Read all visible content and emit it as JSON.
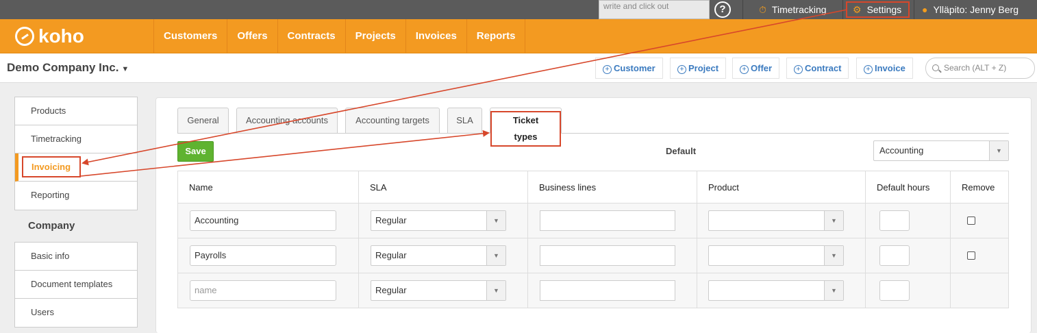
{
  "topbar": {
    "note_text": "write and click out",
    "help": "?",
    "timetracking": "Timetracking",
    "settings": "Settings",
    "user": "Ylläpito: Jenny Berg"
  },
  "brand": {
    "logo": "koho",
    "accent": "#f39a21",
    "annotation": "#d7472b"
  },
  "nav": {
    "items": [
      "Customers",
      "Offers",
      "Contracts",
      "Projects",
      "Invoices",
      "Reports"
    ]
  },
  "header": {
    "company": "Demo Company Inc.",
    "quick_add": [
      "Customer",
      "Project",
      "Offer",
      "Contract",
      "Invoice"
    ],
    "search_placeholder": "Search (ALT + Z)"
  },
  "sidebar": {
    "settings_items": [
      "Products",
      "Timetracking",
      "Invoicing",
      "Reporting"
    ],
    "active": "Invoicing",
    "company_heading": "Company",
    "company_items": [
      "Basic info",
      "Document templates",
      "Users"
    ]
  },
  "tabs": [
    "General",
    "Accounting accounts",
    "Accounting targets",
    "SLA",
    "Ticket types"
  ],
  "active_tab": "Ticket types",
  "toolbar": {
    "save": "Save",
    "default_label": "Default",
    "default_value": "Accounting"
  },
  "table": {
    "headers": [
      "Name",
      "SLA",
      "Business lines",
      "Product",
      "Default hours",
      "Remove"
    ],
    "rows": [
      {
        "name": "Accounting",
        "sla": "Regular",
        "business_lines": "",
        "product": "",
        "hours": "",
        "remove": false
      },
      {
        "name": "Payrolls",
        "sla": "Regular",
        "business_lines": "",
        "product": "",
        "hours": "",
        "remove": false
      },
      {
        "name": "",
        "name_placeholder": "name",
        "sla": "Regular",
        "business_lines": "",
        "product": "",
        "hours": ""
      }
    ]
  }
}
